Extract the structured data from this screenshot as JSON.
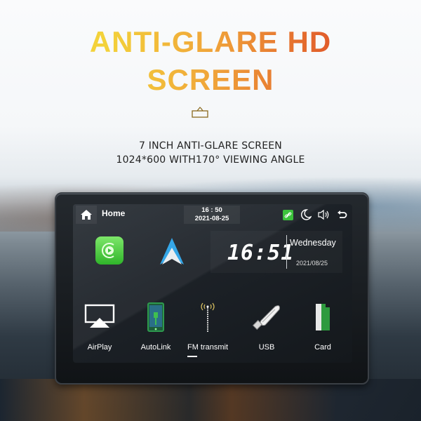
{
  "headline": {
    "line1": "ANTI-GLARE HD",
    "line2": "SCREEN",
    "badge_icon": "screen-badge-icon"
  },
  "subtitle": {
    "line1": "7 INCH ANTI-GLARE SCREEN",
    "line2": "1024*600 WITH170° VIEWING ANGLE"
  },
  "colors": {
    "headline_start": "#f3d23a",
    "headline_end": "#e0582a",
    "carplay_green": "#3cc23c",
    "link_green": "#3cc23c",
    "android_auto_blue": "#35a7e8"
  },
  "screen": {
    "topbar": {
      "home_icon": "home-icon",
      "home_label": "Home",
      "time": "16 : 50",
      "date": "2021-08-25",
      "status_icons": [
        "link-icon",
        "moon-icon",
        "volume-icon",
        "back-icon"
      ]
    },
    "apps": [
      {
        "name": "carplay",
        "icon": "carplay-icon"
      },
      {
        "name": "android-auto",
        "icon": "android-auto-icon"
      }
    ],
    "clock_widget": {
      "time": "16:51",
      "weekday": "Wednesday",
      "date": "2021/08/25"
    },
    "dock": [
      {
        "label": "AirPlay",
        "icon": "airplay-icon"
      },
      {
        "label": "AutoLink",
        "icon": "autolink-icon"
      },
      {
        "label": "FM transmit",
        "icon": "fm-antenna-icon",
        "active": true
      },
      {
        "label": "USB",
        "icon": "usb-icon"
      },
      {
        "label": "Card",
        "icon": "sd-card-icon"
      }
    ]
  }
}
